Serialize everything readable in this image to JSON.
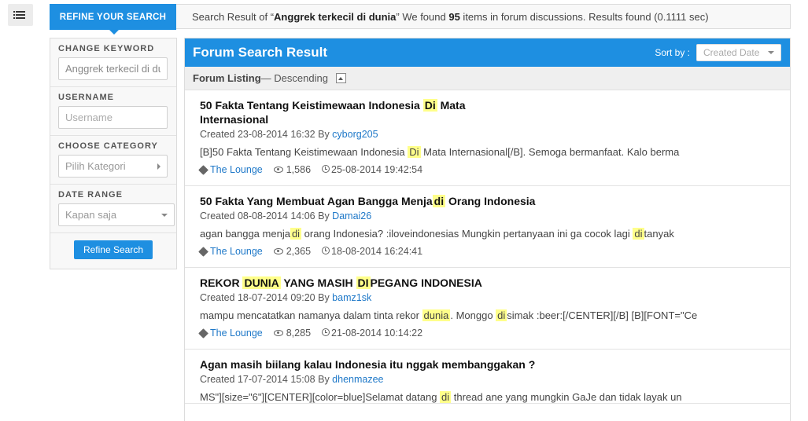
{
  "search": {
    "refine_tab": "REFINE YOUR SEARCH",
    "summary_prefix": "Search Result of “",
    "query": "Anggrek terkecil di dunia",
    "summary_mid": "” We found ",
    "count": "95",
    "summary_suffix": " items in forum discussions. Results found (0.1111 sec)"
  },
  "sidebar": {
    "keyword_label": "CHANGE KEYWORD",
    "keyword_value": "Anggrek terkecil di dunia",
    "username_label": "USERNAME",
    "username_placeholder": "Username",
    "category_label": "CHOOSE CATEGORY",
    "category_placeholder": "Pilih Kategori",
    "date_label": "DATE RANGE",
    "date_value": "Kapan saja",
    "refine_button": "Refine Search"
  },
  "main": {
    "title": "Forum Search Result",
    "sort_label": "Sort by :",
    "sort_value": "Created Date",
    "listing_label": "Forum Listing",
    "listing_order": " — Descending"
  },
  "results": [
    {
      "title_parts": [
        "50 Fakta Tentang Keistimewaan Indonesia ",
        "Di",
        " Mata Internasional"
      ],
      "created": "Created 23-08-2014 16:32 By ",
      "author": "cyborg205",
      "snippet_parts": [
        "[B]50 Fakta Tentang Keistimewaan Indonesia ",
        "Di",
        " Mata Internasional[/B]. Semoga bermanfaat. Kalo berma"
      ],
      "category": "The Lounge",
      "views": "1,586",
      "last_post": "25-08-2014 19:42:54"
    },
    {
      "title_parts": [
        "50 Fakta Yang Membuat Agan Bangga Menja",
        "di",
        " Orang Indonesia"
      ],
      "created": "Created 08-08-2014 14:06 By ",
      "author": "Damai26",
      "snippet_parts": [
        "agan bangga menja",
        "di",
        " orang Indonesia? :iloveindonesias Mungkin pertanyaan ini ga cocok lagi ",
        "di",
        "tanyak"
      ],
      "category": "The Lounge",
      "views": "2,365",
      "last_post": "18-08-2014 16:24:41"
    },
    {
      "title_parts": [
        "REKOR ",
        "DUNIA",
        " YANG MASIH ",
        "DI",
        "PEGANG INDONESIA"
      ],
      "created": "Created 18-07-2014 09:20 By ",
      "author": "bamz1sk",
      "snippet_parts": [
        "mampu mencatatkan namanya dalam tinta rekor ",
        "dunia",
        ". Monggo ",
        "di",
        "simak :beer:[/CENTER][/B] [B][FONT=\"Ce"
      ],
      "category": "The Lounge",
      "views": "8,285",
      "last_post": "21-08-2014 10:14:22"
    },
    {
      "title_parts": [
        "Agan masih biilang kalau Indonesia itu nggak membanggakan ?"
      ],
      "created": "Created 17-07-2014 15:08 By ",
      "author": "dhenmazee",
      "snippet_parts": [
        "MS\"][size=\"6\"][CENTER][color=blue]Selamat datang ",
        "di",
        " thread ane yang mungkin GaJe dan tidak layak un"
      ]
    }
  ]
}
